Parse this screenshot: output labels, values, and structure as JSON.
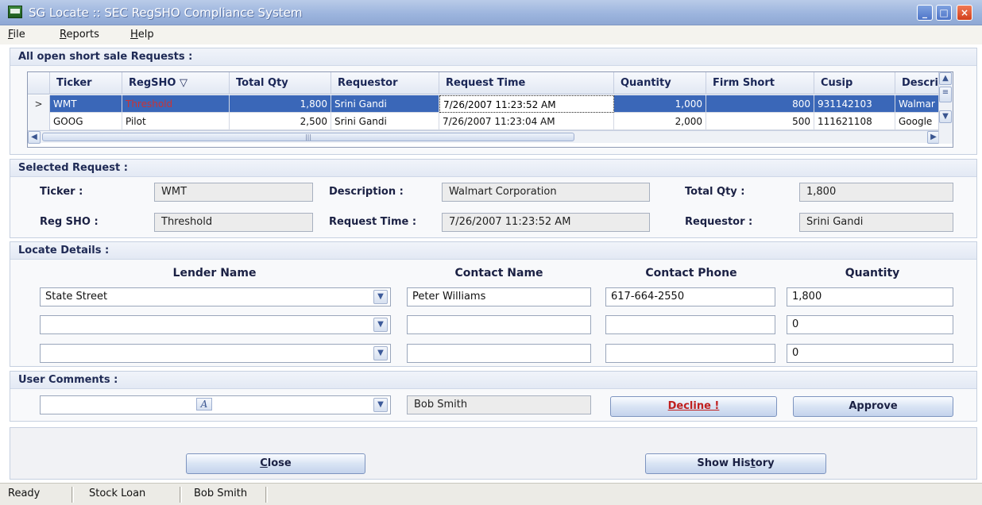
{
  "window": {
    "title": "SG Locate :: SEC RegSHO Compliance System"
  },
  "menu": [
    {
      "label": "File",
      "u": "F"
    },
    {
      "label": "Reports",
      "u": "R"
    },
    {
      "label": "Help",
      "u": "H"
    }
  ],
  "requests": {
    "header": "All open short sale Requests :",
    "columns": [
      "Ticker",
      "RegSHO ▽",
      "Total Qty",
      "Requestor",
      "Request Time",
      "Quantity",
      "Firm Short",
      "Cusip",
      "Descri"
    ],
    "rows": [
      [
        "WMT",
        "Threshold",
        "1,800",
        "Srini Gandi",
        "7/26/2007 11:23:52 AM",
        "1,000",
        "800",
        "931142103",
        "Walmar"
      ],
      [
        "GOOG",
        "Pilot",
        "2,500",
        "Srini Gandi",
        "7/26/2007 11:23:04 AM",
        "2,000",
        "500",
        "111621108",
        "Google"
      ]
    ],
    "selected_marker": ">"
  },
  "selected": {
    "header": "Selected Request :",
    "ticker_label": "Ticker :",
    "ticker": "WMT",
    "description_label": "Description :",
    "description": "Walmart Corporation",
    "totalqty_label": "Total Qty :",
    "totalqty": "1,800",
    "regsho_label": "Reg SHO :",
    "regsho": "Threshold",
    "reqtime_label": "Request Time :",
    "reqtime": "7/26/2007 11:23:52 AM",
    "requestor_label": "Requestor :",
    "requestor": "Srini Gandi"
  },
  "locate": {
    "header": "Locate Details :",
    "col_lender": "Lender Name",
    "col_contact": "Contact Name",
    "col_phone": "Contact Phone",
    "col_qty": "Quantity",
    "rows": [
      {
        "lender": "State Street",
        "contact": "Peter Williams",
        "phone": "617-664-2550",
        "qty": "1,800"
      },
      {
        "lender": "",
        "contact": "",
        "phone": "",
        "qty": "0"
      },
      {
        "lender": "",
        "contact": "",
        "phone": "",
        "qty": "0"
      }
    ]
  },
  "comments": {
    "header": "User Comments :",
    "font_icon": "A",
    "user": "Bob Smith",
    "decline": "Decline !",
    "approve": "Approve"
  },
  "footer": {
    "close_label": "lose",
    "close_u": "C",
    "history_label": "Show His",
    "history_u": "t",
    "history_rest": "ory"
  },
  "status": [
    "Ready",
    "Stock Loan",
    "Bob Smith"
  ]
}
